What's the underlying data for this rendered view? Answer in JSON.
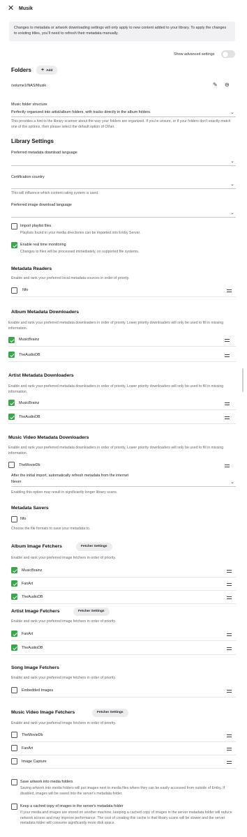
{
  "header": {
    "close_icon": "close-icon",
    "title": "Musik"
  },
  "notice": "Changes to metadata or artwork downloading settings will only apply to new content added to your library. To apply the changes to existing titles, you'll need to refresh their metadata manually.",
  "advanced": {
    "label": "Show advanced settings",
    "enabled": false
  },
  "folders": {
    "title": "Folders",
    "add_label": "Add",
    "path": "/volume1/NAS/Musik"
  },
  "folder_structure": {
    "label": "Music folder structure",
    "value": "Perfectly organized into artist/album folders, with tracks directly in the album folders.",
    "hint": "This provides a hint to the library scanner about the way your folders are organized. If you're unsure, or if your folders don't exactly match one of the options, then please select the default option of Other."
  },
  "library_settings": {
    "title": "Library Settings",
    "metadata_language_label": "Preferred metadata download language",
    "metadata_language_value": "",
    "certification_label": "Certification country",
    "certification_value": "",
    "certification_hint": "This will influence which content rating system is used.",
    "image_language_label": "Preferred image download language",
    "image_language_value": "",
    "import_playlist": {
      "label": "Import playlist files",
      "hint": "Playlists found in your media directories can be imported into Emby Server.",
      "checked": false
    },
    "realtime": {
      "label": "Enable real time monitoring",
      "hint": "Changes to files will be processed immediately, on supported file systems.",
      "checked": true
    }
  },
  "metadata_readers": {
    "title": "Metadata Readers",
    "desc": "Enable and rank your preferred local metadata sources in order of priority.",
    "items": [
      {
        "label": "Nfo",
        "checked": false
      }
    ]
  },
  "album_downloaders": {
    "title": "Album Metadata Downloaders",
    "desc": "Enable and rank your preferred metadata downloaders in order of priority. Lower priority downloaders will only be used to fill in missing information.",
    "items": [
      {
        "label": "MusicBrainz",
        "checked": true
      },
      {
        "label": "TheAudioDB",
        "checked": true
      }
    ]
  },
  "artist_downloaders": {
    "title": "Artist Metadata Downloaders",
    "desc": "Enable and rank your preferred metadata downloaders in order of priority. Lower priority downloaders will only be used to fill in missing information.",
    "items": [
      {
        "label": "MusicBrainz",
        "checked": true
      },
      {
        "label": "TheAudioDB",
        "checked": true
      }
    ]
  },
  "video_downloaders": {
    "title": "Music Video Metadata Downloaders",
    "desc": "Enable and rank your preferred metadata downloaders in order of priority. Lower priority downloaders will only be used to fill in missing information.",
    "items": [
      {
        "label": "TheMovieDb",
        "checked": false
      }
    ]
  },
  "refresh": {
    "label": "After the initial import, automatically refresh metadata from the internet",
    "value": "Never",
    "hint": "Enabling this option may result in significantly longer library scans."
  },
  "metadata_savers": {
    "title": "Metadata Savers",
    "items": [
      {
        "label": "Nfo",
        "checked": false
      }
    ],
    "desc": "Choose the file formats to save your metadata to."
  },
  "album_image_fetchers": {
    "title": "Album Image Fetchers",
    "settings_label": "Fetcher Settings",
    "desc": "Enable and rank your preferred image fetchers in order of priority.",
    "items": [
      {
        "label": "MusicBrainz",
        "checked": true
      },
      {
        "label": "FanArt",
        "checked": true
      },
      {
        "label": "TheAudioDB",
        "checked": true
      }
    ]
  },
  "artist_image_fetchers": {
    "title": "Artist Image Fetchers",
    "settings_label": "Fetcher Settings",
    "desc": "Enable and rank your preferred image fetchers in order of priority.",
    "items": [
      {
        "label": "FanArt",
        "checked": true
      },
      {
        "label": "TheAudioDB",
        "checked": true
      }
    ]
  },
  "song_image_fetchers": {
    "title": "Song Image Fetchers",
    "desc": "Enable and rank your preferred image fetchers in order of priority.",
    "items": [
      {
        "label": "Embedded Images",
        "checked": false
      }
    ]
  },
  "video_image_fetchers": {
    "title": "Music Video Image Fetchers",
    "settings_label": "Fetcher Settings",
    "desc": "Enable and rank your preferred image fetchers in order of priority.",
    "items": [
      {
        "label": "TheMovieDb",
        "checked": false
      },
      {
        "label": "FanArt",
        "checked": false
      },
      {
        "label": "Image Capture",
        "checked": false
      }
    ]
  },
  "save_artwork": {
    "label": "Save artwork into media folders",
    "hint": "Saving artwork into media folders will put images next to media files where they can be easily accessed from outside of Emby. If disabled, images will be saved into the server's metadata folder.",
    "checked": false
  },
  "cache_images": {
    "label": "Keep a cached copy of images in the server's metadata folder",
    "hint": "If your media and images are stored on another machine, keeping a cached copy of images in the server metadata folder will reduce network access and may improve performance. The cost of creating this cache is that library scans will be slower and the server metadata folder will consume significantly more disk space.",
    "checked": false
  },
  "colors": {
    "accent": "#3aa54a",
    "notice_bg": "#f1f1f3",
    "pill_bg": "#ececef"
  }
}
